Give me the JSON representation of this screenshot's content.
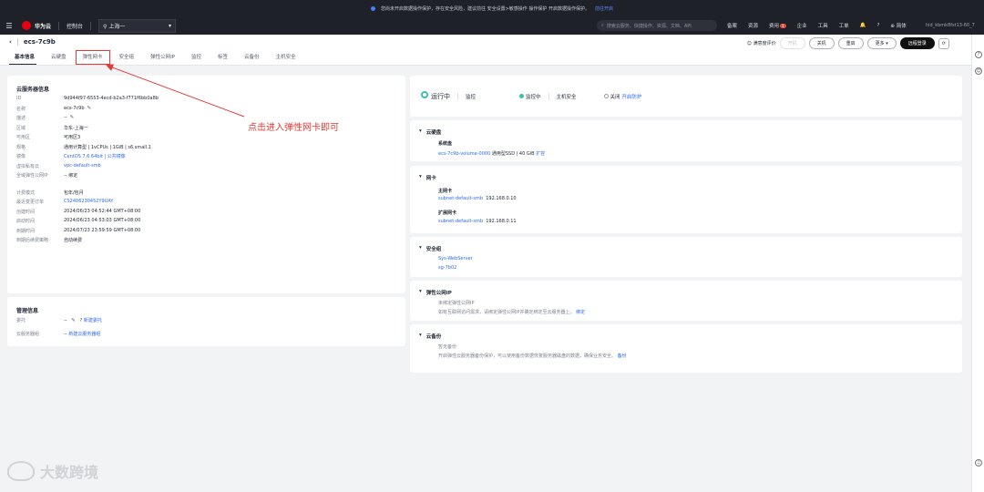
{
  "banner": {
    "text": "您尚未开启数据操作保护，存在安全风险，建议前往 安全设置>敏感操作 操作保护 开启数据操作保护。",
    "link": "前往开启"
  },
  "topbar": {
    "brand_cn": "华为云",
    "console": "控制台",
    "region": "上海一",
    "search_placeholder": "搜索云服务、快捷操作、资源、文档、API",
    "nav": [
      "备案",
      "资源",
      "费用",
      "企业",
      "工具",
      "工单"
    ],
    "fee_badge": "1",
    "lang": "简体",
    "account": "hid_kbmk8fst13-60_7"
  },
  "header": {
    "instance_name": "ecs-7c9b",
    "feedback": "满意度评价",
    "buttons": {
      "power_on": "开机",
      "power_off": "关机",
      "restart": "重启",
      "more": "更多",
      "remote_login": "远程登录"
    }
  },
  "tabs": [
    "基本信息",
    "云硬盘",
    "弹性网卡",
    "安全组",
    "弹性公网IP",
    "监控",
    "标签",
    "云备份",
    "主机安全"
  ],
  "server_info": {
    "title": "云服务器信息",
    "rows": [
      {
        "k": "ID",
        "v": "9d944f97-6553-4ecd-b2a3-f771f6bb0a8b"
      },
      {
        "k": "名称",
        "v": "ecs-7c9b"
      },
      {
        "k": "描述",
        "v": "--"
      },
      {
        "k": "区域",
        "v": "华东-上海一"
      },
      {
        "k": "可用区",
        "v": "可用区3"
      },
      {
        "k": "规格",
        "v": "通用计算型 | 1vCPUs | 1GiB | s6.small.1"
      },
      {
        "k": "镜像",
        "v": "CentOS 7.6 64bit | 公共镜像"
      },
      {
        "k": "虚拟私有云",
        "v": "vpc-default-smb"
      },
      {
        "k": "全域弹性公网IP",
        "v": "--  绑定"
      },
      {
        "k": "计费模式",
        "v": "包年/包月"
      },
      {
        "k": "最近变更订单",
        "v": "CS2406230452Y9UAY"
      },
      {
        "k": "创建时间",
        "v": "2024/06/23 04:52:44 GMT+08:00"
      },
      {
        "k": "启动时间",
        "v": "2024/06/23 04:53:03 GMT+08:00"
      },
      {
        "k": "到期时间",
        "v": "2024/07/23 23:59:59 GMT+08:00"
      },
      {
        "k": "到期后续费策略",
        "v": "自动续费"
      }
    ]
  },
  "mgmt_info": {
    "title": "管理信息",
    "rows": [
      {
        "k": "委托",
        "v": "--",
        "link": "新建委托"
      },
      {
        "k": "云服务器组",
        "v": "--",
        "link": "新建云服务器组"
      }
    ]
  },
  "annotation": "点击进入弹性网卡即可",
  "status": {
    "state": "运行中",
    "monitor_label": "监控",
    "monitor_state": "监控中",
    "hss_label": "主机安全",
    "hss_state": "关闭",
    "hss_link": "开启防护"
  },
  "disk": {
    "title": "云硬盘",
    "sys_label": "系统盘",
    "volume": "ecs-7c9b-volume-0000",
    "spec": "通用型SSD | 40 GiB",
    "expand": "扩容"
  },
  "nic": {
    "title": "网卡",
    "primary_label": "主网卡",
    "primary_subnet": "subnet-default-smb",
    "primary_ip": "192.168.0.10",
    "ext_label": "扩展网卡",
    "ext_subnet": "subnet-default-smb",
    "ext_ip": "192.168.0.11"
  },
  "secgroup": {
    "title": "安全组",
    "items": [
      "Sys-WebServer",
      "sg-7b02"
    ]
  },
  "eip": {
    "title": "弹性公网IP",
    "none": "未绑定弹性公网IP",
    "hint": "如有互联网访问需求，请绑定弹性公网IP并确定绑定至云服务器上。",
    "link": "绑定"
  },
  "backup": {
    "title": "云备份",
    "none": "暂无备份",
    "hint": "开启弹性云服务器备份保护，可以使用备份数据恢复服务器磁盘的数据，确保业务安全。",
    "link": "备份"
  },
  "watermark": "大数跨境",
  "colors": {
    "accent": "#2d6af2",
    "annotation": "#e53935",
    "running": "#3ac1a8"
  }
}
